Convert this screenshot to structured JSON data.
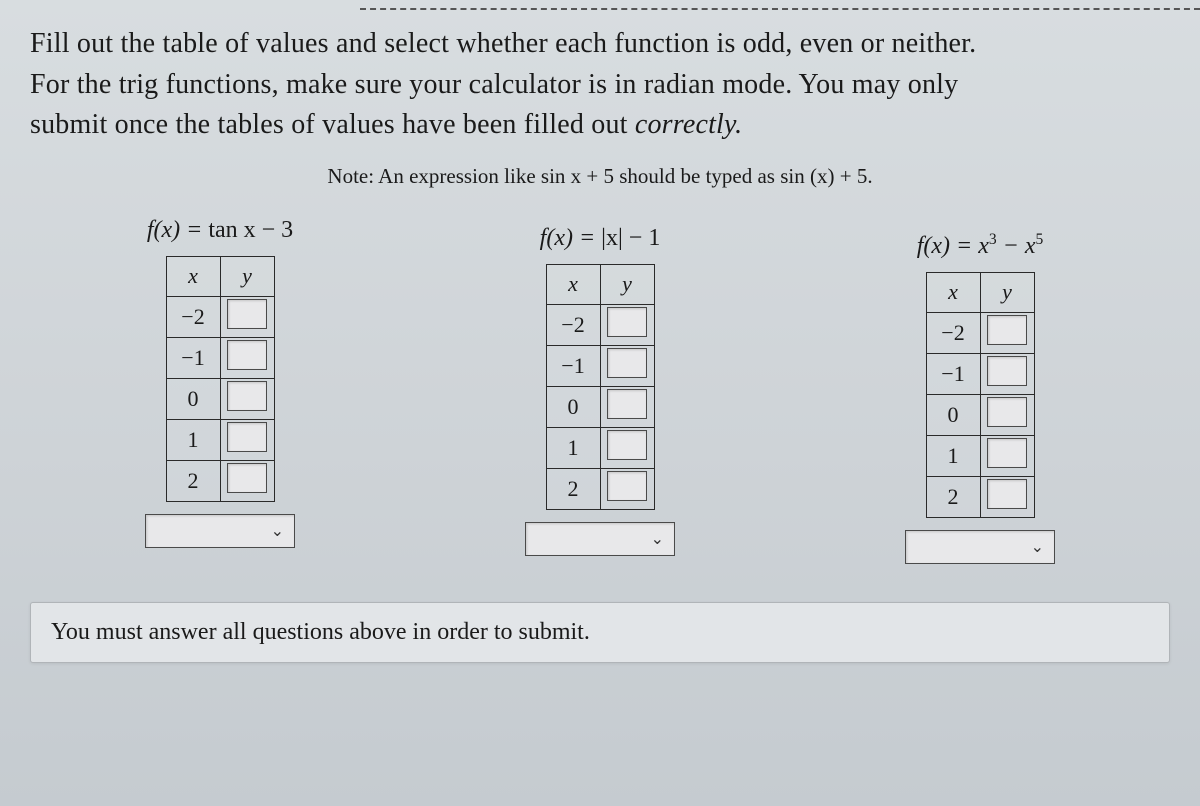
{
  "instructions": {
    "line1": "Fill out the table of values and select whether each function is odd, even or neither.",
    "line2a": "For the trig functions, make sure your calculator is in radian mode. You may only",
    "line2b": "submit once the tables of values have been filled out ",
    "line2c_italic": "correctly."
  },
  "note": {
    "prefix": "Note: An expression like ",
    "expr1": "sin x + 5",
    "mid": " should be typed as ",
    "expr2": "sin (x) + 5",
    "suffix": "."
  },
  "headers": {
    "x": "x",
    "y": "y"
  },
  "problems": [
    {
      "fn_prefix": "f(x) = ",
      "fn_body": "tan x − 3",
      "x_values": [
        "−2",
        "−1",
        "0",
        "1",
        "2"
      ]
    },
    {
      "fn_prefix": "f(x) = ",
      "fn_body": "|x| − 1",
      "x_values": [
        "−2",
        "−1",
        "0",
        "1",
        "2"
      ]
    },
    {
      "fn_prefix": "f(x) = ",
      "fn_base": "x",
      "fn_sup1": "3",
      "fn_mid": " − x",
      "fn_sup2": "5",
      "x_values": [
        "−2",
        "−1",
        "0",
        "1",
        "2"
      ]
    }
  ],
  "footer": "You must answer all questions above in order to submit."
}
